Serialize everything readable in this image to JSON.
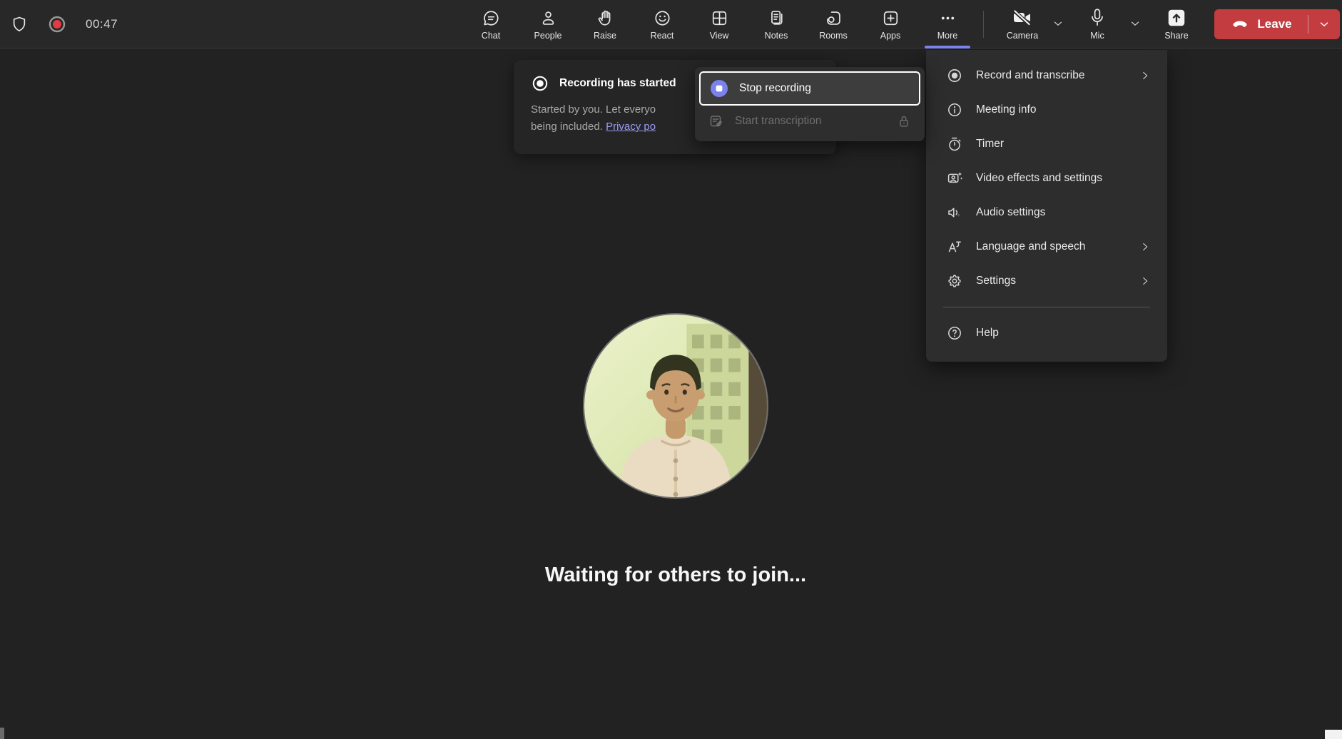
{
  "topbar": {
    "timer": "00:47",
    "nav": [
      {
        "label": "Chat",
        "icon": "chat-icon"
      },
      {
        "label": "People",
        "icon": "people-icon"
      },
      {
        "label": "Raise",
        "icon": "raise-hand-icon"
      },
      {
        "label": "React",
        "icon": "react-icon"
      },
      {
        "label": "View",
        "icon": "view-icon"
      },
      {
        "label": "Notes",
        "icon": "notes-icon"
      },
      {
        "label": "Rooms",
        "icon": "rooms-icon"
      },
      {
        "label": "Apps",
        "icon": "apps-icon"
      },
      {
        "label": "More",
        "icon": "more-icon",
        "active": true
      }
    ],
    "camera": {
      "label": "Camera",
      "state": "off"
    },
    "mic": {
      "label": "Mic",
      "state": "on"
    },
    "share": {
      "label": "Share"
    },
    "leave": {
      "label": "Leave"
    }
  },
  "toast": {
    "icon": "record-icon",
    "title": "Recording has started",
    "body_line1": "Started by you. Let everyo",
    "body_line2_prefix": "being included. ",
    "body_link": "Privacy po"
  },
  "recording_menu": {
    "items": [
      {
        "label": "Stop recording",
        "icon": "stop-recording-icon",
        "state": "focused"
      },
      {
        "label": "Start transcription",
        "icon": "transcription-icon",
        "state": "disabled",
        "trailing_icon": "lock-icon"
      }
    ]
  },
  "more_menu": {
    "items": [
      {
        "label": "Record and transcribe",
        "icon": "record-icon",
        "submenu": true
      },
      {
        "label": "Meeting info",
        "icon": "info-icon",
        "submenu": false
      },
      {
        "label": "Timer",
        "icon": "timer-icon",
        "submenu": false
      },
      {
        "label": "Video effects and settings",
        "icon": "video-effects-icon",
        "submenu": false
      },
      {
        "label": "Audio settings",
        "icon": "audio-settings-icon",
        "submenu": false
      },
      {
        "label": "Language and speech",
        "icon": "language-icon",
        "submenu": true
      },
      {
        "label": "Settings",
        "icon": "settings-icon",
        "submenu": true
      }
    ],
    "footer_items": [
      {
        "label": "Help",
        "icon": "help-icon"
      }
    ]
  },
  "stage": {
    "waiting_text": "Waiting for others to join..."
  },
  "colors": {
    "accent": "#7b83eb",
    "leave_red": "#c33c40",
    "link": "#9a9cf0",
    "record_red": "#e23b41",
    "topbar_bg": "#282828",
    "stage_bg": "#222222",
    "menu_bg": "#2d2d2d"
  }
}
